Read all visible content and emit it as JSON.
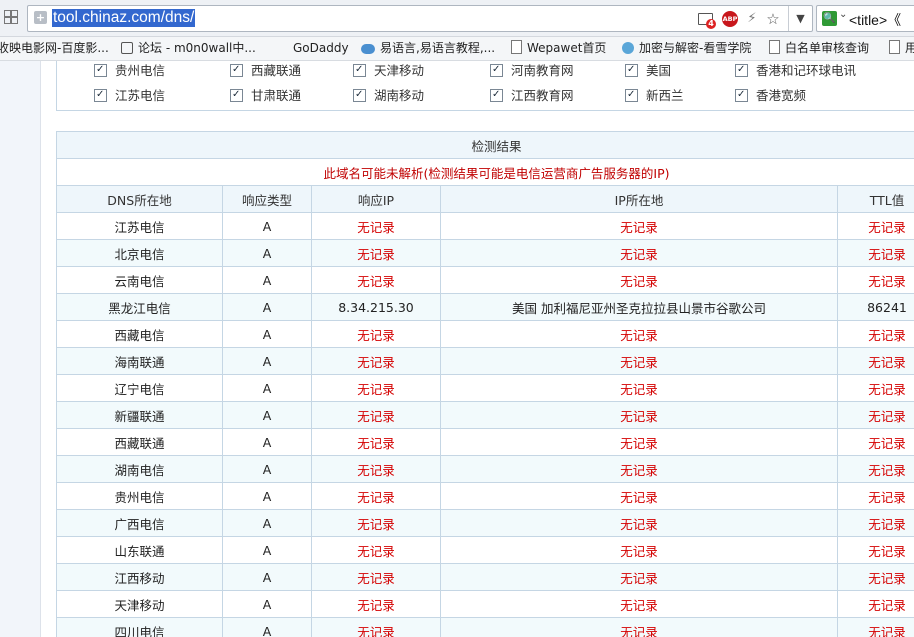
{
  "browser": {
    "url": "tool.chinaz.com/dns/",
    "notification_count": "4",
    "abp_label": "ABP",
    "search_text": "<title>《"
  },
  "bookmarks": [
    {
      "label": "收映电影网-百度影..."
    },
    {
      "label": "论坛 - m0n0wall中..."
    },
    {
      "label": "GoDaddy"
    },
    {
      "label": "易语言,易语言教程,..."
    },
    {
      "label": "Wepawet首页"
    },
    {
      "label": "加密与解密-看雪学院"
    },
    {
      "label": "白名单审核查询"
    },
    {
      "label": "用"
    }
  ],
  "options": {
    "row1": [
      "贵州电信",
      "西藏联通",
      "天津移动",
      "河南教育网",
      "美国",
      "香港和记环球电讯"
    ],
    "row2": [
      "江苏电信",
      "甘肃联通",
      "湖南移动",
      "江西教育网",
      "新西兰",
      "香港宽频"
    ]
  },
  "results": {
    "title": "检测结果",
    "warning": "此域名可能未解析(检测结果可能是电信运营商广告服务器的IP)",
    "headers": [
      "DNS所在地",
      "响应类型",
      "响应IP",
      "IP所在地",
      "TTL值"
    ],
    "rows": [
      {
        "loc": "江苏电信",
        "type": "A",
        "ip": "无记录",
        "place": "无记录",
        "ttl": "无记录",
        "found": false
      },
      {
        "loc": "北京电信",
        "type": "A",
        "ip": "无记录",
        "place": "无记录",
        "ttl": "无记录",
        "found": false
      },
      {
        "loc": "云南电信",
        "type": "A",
        "ip": "无记录",
        "place": "无记录",
        "ttl": "无记录",
        "found": false
      },
      {
        "loc": "黑龙江电信",
        "type": "A",
        "ip": "8.34.215.30",
        "place": "美国 加利福尼亚州圣克拉拉县山景市谷歌公司",
        "ttl": "86241",
        "found": true
      },
      {
        "loc": "西藏电信",
        "type": "A",
        "ip": "无记录",
        "place": "无记录",
        "ttl": "无记录",
        "found": false
      },
      {
        "loc": "海南联通",
        "type": "A",
        "ip": "无记录",
        "place": "无记录",
        "ttl": "无记录",
        "found": false
      },
      {
        "loc": "辽宁电信",
        "type": "A",
        "ip": "无记录",
        "place": "无记录",
        "ttl": "无记录",
        "found": false
      },
      {
        "loc": "新疆联通",
        "type": "A",
        "ip": "无记录",
        "place": "无记录",
        "ttl": "无记录",
        "found": false
      },
      {
        "loc": "西藏联通",
        "type": "A",
        "ip": "无记录",
        "place": "无记录",
        "ttl": "无记录",
        "found": false
      },
      {
        "loc": "湖南电信",
        "type": "A",
        "ip": "无记录",
        "place": "无记录",
        "ttl": "无记录",
        "found": false
      },
      {
        "loc": "贵州电信",
        "type": "A",
        "ip": "无记录",
        "place": "无记录",
        "ttl": "无记录",
        "found": false
      },
      {
        "loc": "广西电信",
        "type": "A",
        "ip": "无记录",
        "place": "无记录",
        "ttl": "无记录",
        "found": false
      },
      {
        "loc": "山东联通",
        "type": "A",
        "ip": "无记录",
        "place": "无记录",
        "ttl": "无记录",
        "found": false
      },
      {
        "loc": "江西移动",
        "type": "A",
        "ip": "无记录",
        "place": "无记录",
        "ttl": "无记录",
        "found": false
      },
      {
        "loc": "天津移动",
        "type": "A",
        "ip": "无记录",
        "place": "无记录",
        "ttl": "无记录",
        "found": false
      },
      {
        "loc": "四川电信",
        "type": "A",
        "ip": "无记录",
        "place": "无记录",
        "ttl": "无记录",
        "found": false
      }
    ]
  },
  "colors": {
    "no_record": "#d40000",
    "warning": "#c00000",
    "header_bg": "#eef6fb",
    "border": "#c5d6e4",
    "url_highlight": "#3368cf"
  }
}
